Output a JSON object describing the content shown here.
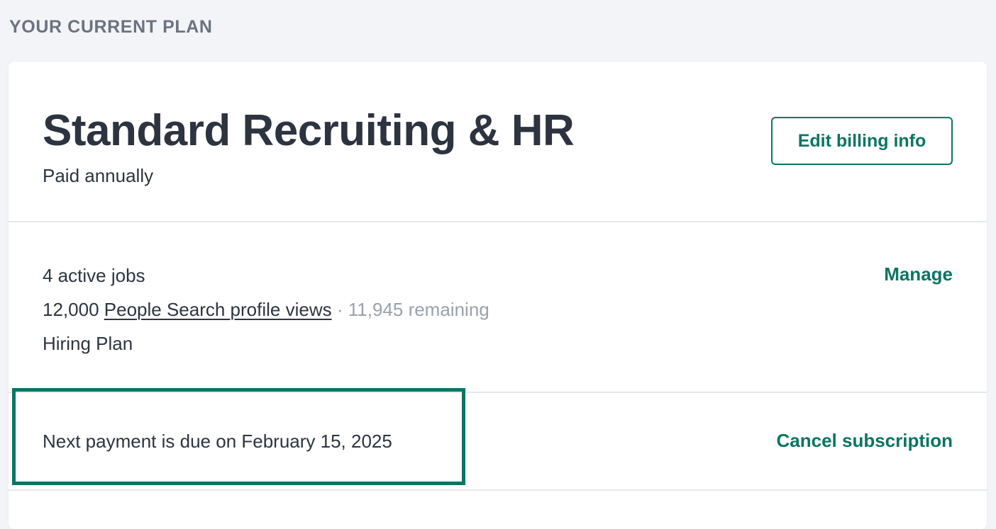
{
  "section_heading": "YOUR CURRENT PLAN",
  "plan": {
    "title": "Standard Recruiting & HR",
    "billing_cycle": "Paid annually",
    "edit_billing_label": "Edit billing info"
  },
  "usage": {
    "active_jobs": "4 active jobs",
    "profile_views_count": "12,000",
    "profile_views_link": "People Search profile views",
    "separator": "·",
    "remaining": "11,945 remaining",
    "hiring_plan": "Hiring Plan",
    "manage_label": "Manage"
  },
  "payment": {
    "next_payment": "Next payment is due on February 15, 2025",
    "cancel_label": "Cancel subscription"
  },
  "colors": {
    "accent": "#0b7563",
    "text": "#2d3440",
    "muted": "#9aa1ad",
    "heading": "#6b7280",
    "background": "#f3f4f7"
  }
}
